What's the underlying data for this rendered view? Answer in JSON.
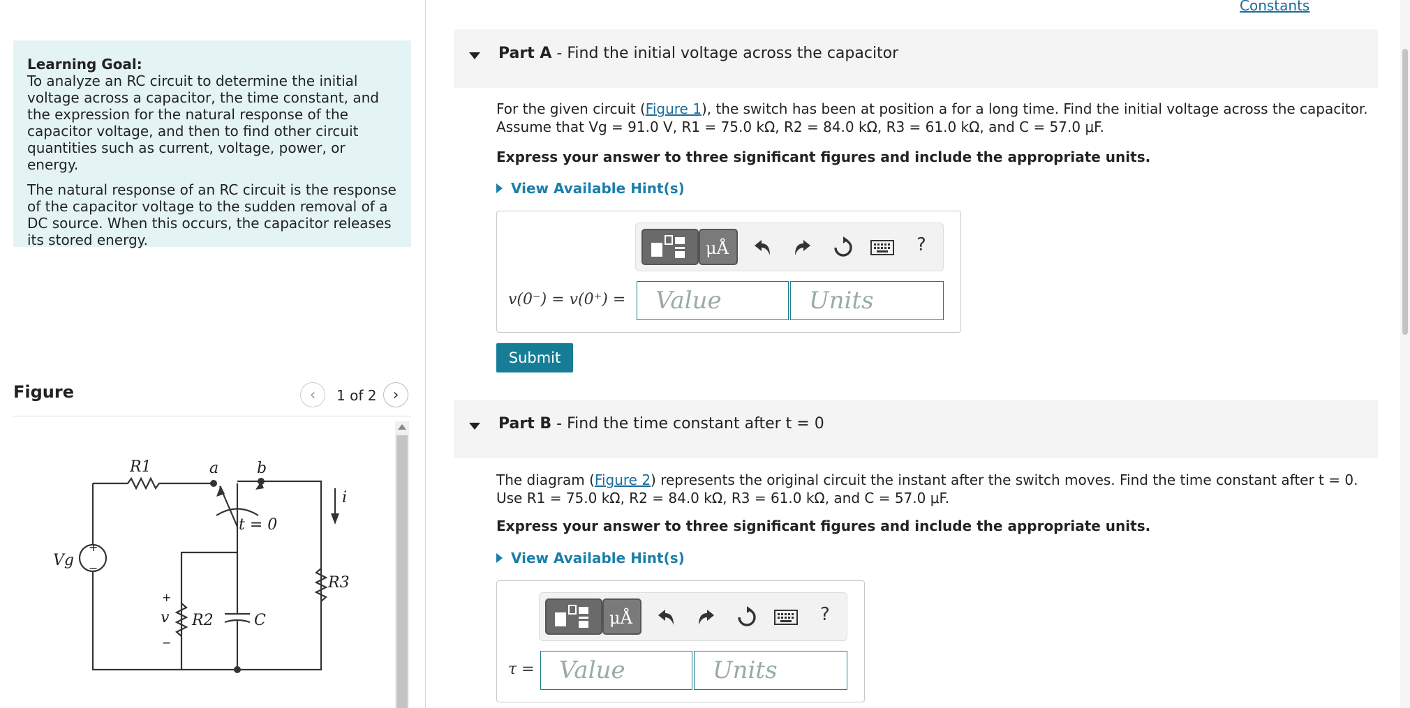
{
  "goal": {
    "title": "Learning Goal:",
    "intro": "To analyze an RC circuit to determine the initial voltage across a capacitor, the time constant, and the expression for the natural response of the capacitor voltage, and then to find other circuit quantities such as current, voltage, power, or energy.",
    "body": "The natural response of an RC circuit is the response of the capacitor voltage to the sudden removal of a DC source. When this occurs, the capacitor releases its stored energy."
  },
  "figure": {
    "title": "Figure",
    "pager": "1 of 2",
    "labels": {
      "r1": "R1",
      "a": "a",
      "b": "b",
      "i": "i",
      "t0": "t = 0",
      "vg": "Vg",
      "r3": "R3",
      "v": "v",
      "r2": "R2",
      "c": "C",
      "plus": "+",
      "minus": "−"
    }
  },
  "constants_link": "Constants",
  "part_a": {
    "label": "Part A",
    "title": " - Find the initial voltage across the capacitor",
    "text": "For the given circuit (Figure 1), the switch has been at position a for a long time. Find the initial voltage across the capacitor. Assume that Vg = 91.0 V, R1 = 75.0 kΩ, R2 = 84.0 kΩ, R3 = 61.0 kΩ, and C = 57.0 μF.",
    "text_pre": "For the given circuit (",
    "text_link": "Figure 1",
    "text_post": "), the switch has been at position a for a long time. Find the initial voltage across the capacitor. Assume that Vg = 91.0 V, R1 = 75.0 kΩ, R2 = 84.0 kΩ, R3 = 61.0 kΩ, and C = 57.0 μF.",
    "instruction": "Express your answer to three significant figures and include the appropriate units.",
    "hints": "View Available Hint(s)",
    "answer_label": "v(0⁻) = v(0⁺) =",
    "value_placeholder": "Value",
    "units_placeholder": "Units",
    "submit": "Submit"
  },
  "part_b": {
    "label": "Part B",
    "title": " - Find the time constant after t = 0",
    "text_pre": "The diagram (",
    "text_link": "Figure 2",
    "text_post": ") represents the original circuit the instant after the switch moves. Find the time constant after t = 0. Use R1 = 75.0 kΩ, R2 = 84.0 kΩ, R3 = 61.0 kΩ, and C = 57.0 μF.",
    "instruction": "Express your answer to three significant figures and include the appropriate units.",
    "hints": "View Available Hint(s)",
    "answer_label": "τ =",
    "value_placeholder": "Value",
    "units_placeholder": "Units"
  },
  "toolbar": {
    "units_btn": "μÅ",
    "help": "?",
    "icons": [
      "templates-icon",
      "units-icon",
      "undo-icon",
      "redo-icon",
      "reset-icon",
      "keyboard-icon",
      "help-icon"
    ]
  }
}
